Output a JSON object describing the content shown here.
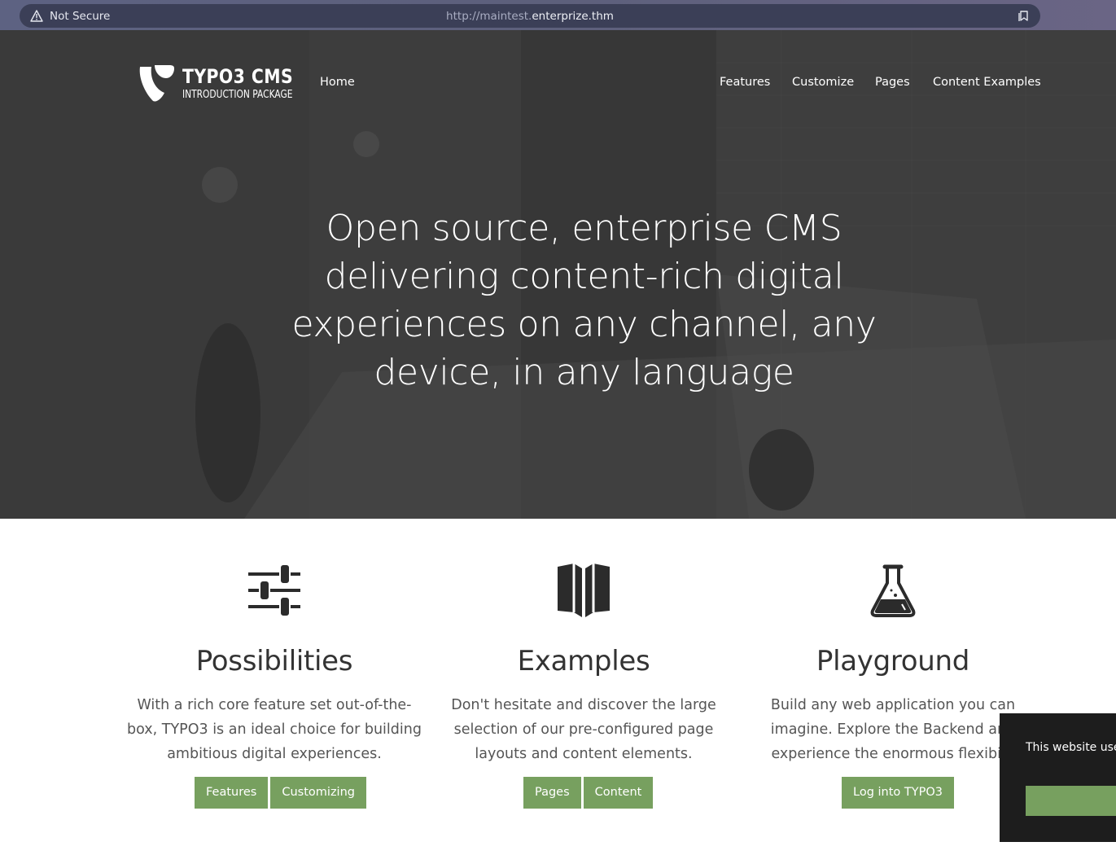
{
  "browser": {
    "security_label": "Not Secure",
    "url_scheme_prefix": "http://maintest.",
    "url_host": "enterprize.thm"
  },
  "site": {
    "logo_title": "TYPO3 CMS",
    "logo_subtitle": "INTRODUCTION PACKAGE",
    "nav_left": "Home",
    "nav_right": [
      "Features",
      "Customize",
      "Pages",
      "Content Examples"
    ],
    "headline": "Open source, enterprise CMS delivering content-rich digital experiences on any channel, any device, in any language"
  },
  "features": [
    {
      "icon": "sliders-icon",
      "title": "Possibilities",
      "text": "With a rich core feature set out-of-the-box, TYPO3 is an ideal choice for building ambitious digital experiences.",
      "buttons": [
        "Features",
        "Customizing"
      ]
    },
    {
      "icon": "book-icon",
      "title": "Examples",
      "text": "Don't hesitate and discover the large selection of our pre-configured page layouts and content elements.",
      "buttons": [
        "Pages",
        "Content"
      ]
    },
    {
      "icon": "flask-icon",
      "title": "Playground",
      "text": "Build any web application you can imagine. Explore the Backend and experience the enormous flexibilit",
      "buttons": [
        "Log into TYPO3"
      ]
    }
  ],
  "cookie": {
    "message": "This website use best experience o"
  },
  "colors": {
    "accent_green": "#77a05f",
    "hero_overlay": "#323232",
    "chrome_bar": "#5d6282"
  }
}
